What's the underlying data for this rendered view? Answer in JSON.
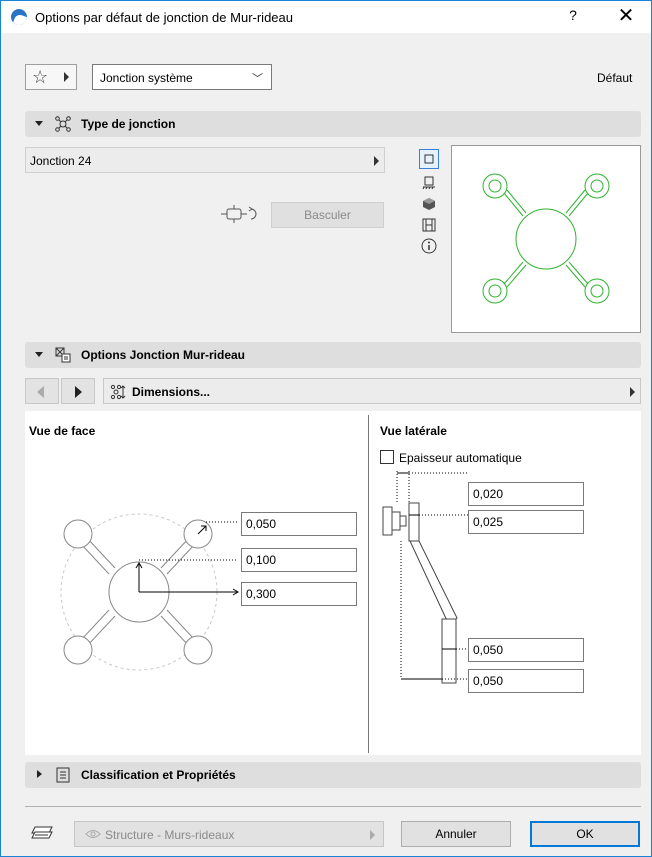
{
  "window": {
    "title": "Options par défaut de jonction de Mur-rideau",
    "help_label": "?",
    "close_label": "✕"
  },
  "toolbar": {
    "favorites_icon": "star-icon",
    "selection": "Jonction système",
    "default_label": "Défaut"
  },
  "type_section": {
    "title": "Type de jonction",
    "selected_type": "Jonction 24",
    "swap_button": "Basculer",
    "view_buttons": [
      "plan-view-icon",
      "section-view-icon",
      "3d-view-icon",
      "film-icon",
      "info-icon"
    ],
    "preview_color": "#2fb22f"
  },
  "options_section": {
    "title": "Options Jonction Mur-rideau",
    "page_label": "Dimensions...",
    "front_view": {
      "title": "Vue de face",
      "fields": [
        "0,050",
        "0,100",
        "0,300"
      ]
    },
    "side_view": {
      "title": "Vue latérale",
      "auto_thickness_label": "Epaisseur automatique",
      "auto_thickness_checked": false,
      "fields": [
        "0,020",
        "0,025",
        "0,050",
        "0,050"
      ]
    }
  },
  "classification_section": {
    "title": "Classification et Propriétés"
  },
  "footer": {
    "layer_label": "Structure - Murs-rideaux",
    "cancel_label": "Annuler",
    "ok_label": "OK"
  }
}
